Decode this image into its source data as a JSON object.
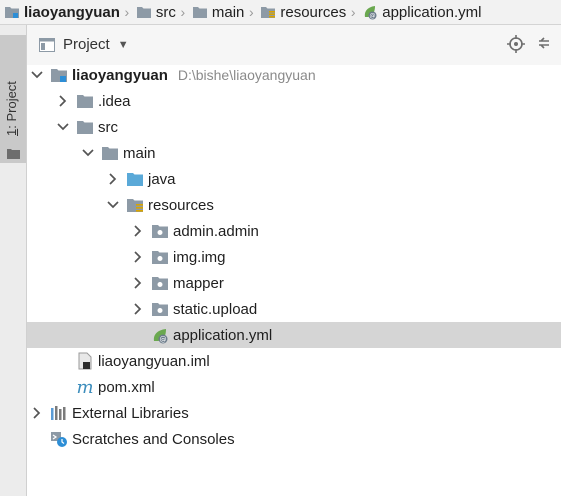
{
  "breadcrumb": {
    "items": [
      {
        "label": "liaoyangyuan",
        "icon": "project-folder-icon"
      },
      {
        "label": "src",
        "icon": "folder-icon"
      },
      {
        "label": "main",
        "icon": "folder-icon"
      },
      {
        "label": "resources",
        "icon": "resources-folder-icon"
      },
      {
        "label": "application.yml",
        "icon": "spring-yml-icon"
      }
    ]
  },
  "stripe": {
    "tab_number": "1",
    "tab_label": ": Project"
  },
  "tool_window": {
    "title": "Project",
    "actions": [
      "locate-icon",
      "collapse-all-icon"
    ]
  },
  "tree": {
    "root": {
      "label": "liaoyangyuan",
      "path": "D:\\bishe\\liaoyangyuan"
    },
    "idea": {
      "label": ".idea"
    },
    "src": {
      "label": "src"
    },
    "main": {
      "label": "main"
    },
    "java": {
      "label": "java"
    },
    "resources": {
      "label": "resources"
    },
    "admin": {
      "label": "admin.admin"
    },
    "img": {
      "label": "img.img"
    },
    "mapper": {
      "label": "mapper"
    },
    "static": {
      "label": "static.upload"
    },
    "application": {
      "label": "application.yml",
      "selected": true
    },
    "iml": {
      "label": "liaoyangyuan.iml"
    },
    "pom": {
      "label": "pom.xml"
    },
    "libraries": {
      "label": "External Libraries"
    },
    "scratches": {
      "label": "Scratches and Consoles"
    }
  },
  "colors": {
    "folder": "#8d9aa6",
    "java_folder": "#5aa9d8",
    "spring": "#6aa84f",
    "maven": "#3c8dbc",
    "selection": "#d5d5d5"
  }
}
